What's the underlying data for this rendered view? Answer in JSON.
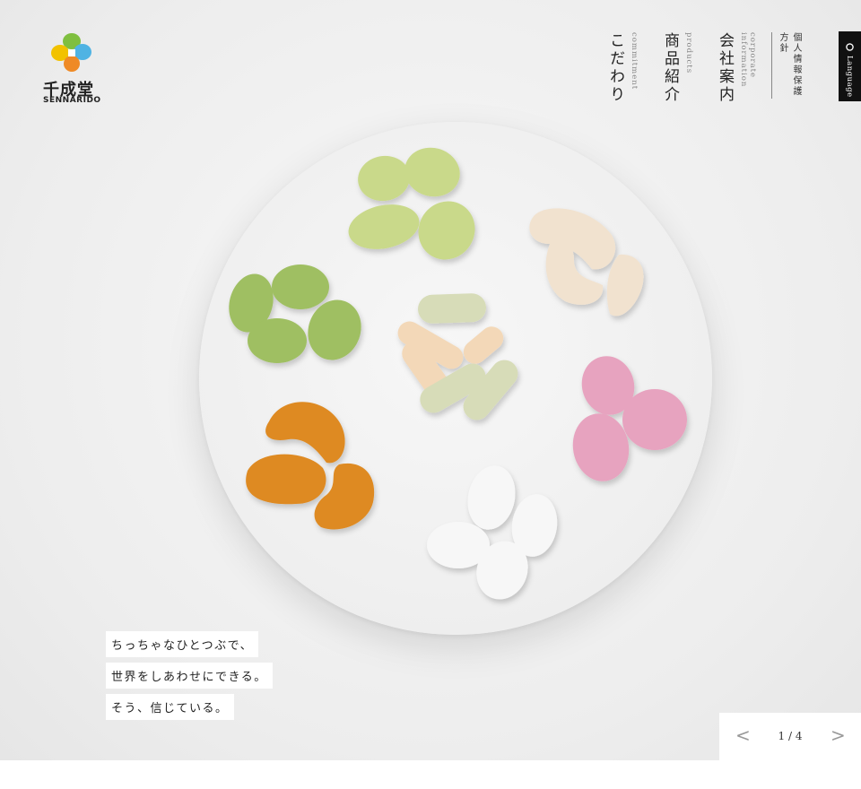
{
  "brand": {
    "name": "千成堂",
    "romanized": "SENNARIDO"
  },
  "nav": {
    "items": [
      {
        "jp": "会社案内",
        "en": "corporate information"
      },
      {
        "jp": "商品紹介",
        "en": "products"
      },
      {
        "jp": "こだわり",
        "en": "commitment"
      }
    ],
    "privacy": "個人情報保護方針",
    "language": "Language"
  },
  "hero": {
    "copy": [
      "ちっちゃなひとつぶで、",
      "世界をしあわせにできる。",
      "そう、信じている。"
    ]
  },
  "slider": {
    "counter": "1 / 4",
    "prev_icon": "chevron-left-icon",
    "next_icon": "chevron-right-icon"
  },
  "colors": {
    "matcha": "#9fbf62",
    "sour": "#c9d98a",
    "cashew": "#f1e2cf",
    "rice_cracker": "#f3d8b8",
    "nori": "#d7dcb8",
    "pink": "#e7a3bf",
    "spicy": "#de8a22",
    "white": "#f7f7f7",
    "logo": [
      "#7fbf3f",
      "#f2c200",
      "#4fb3e3",
      "#ef8a26"
    ]
  }
}
